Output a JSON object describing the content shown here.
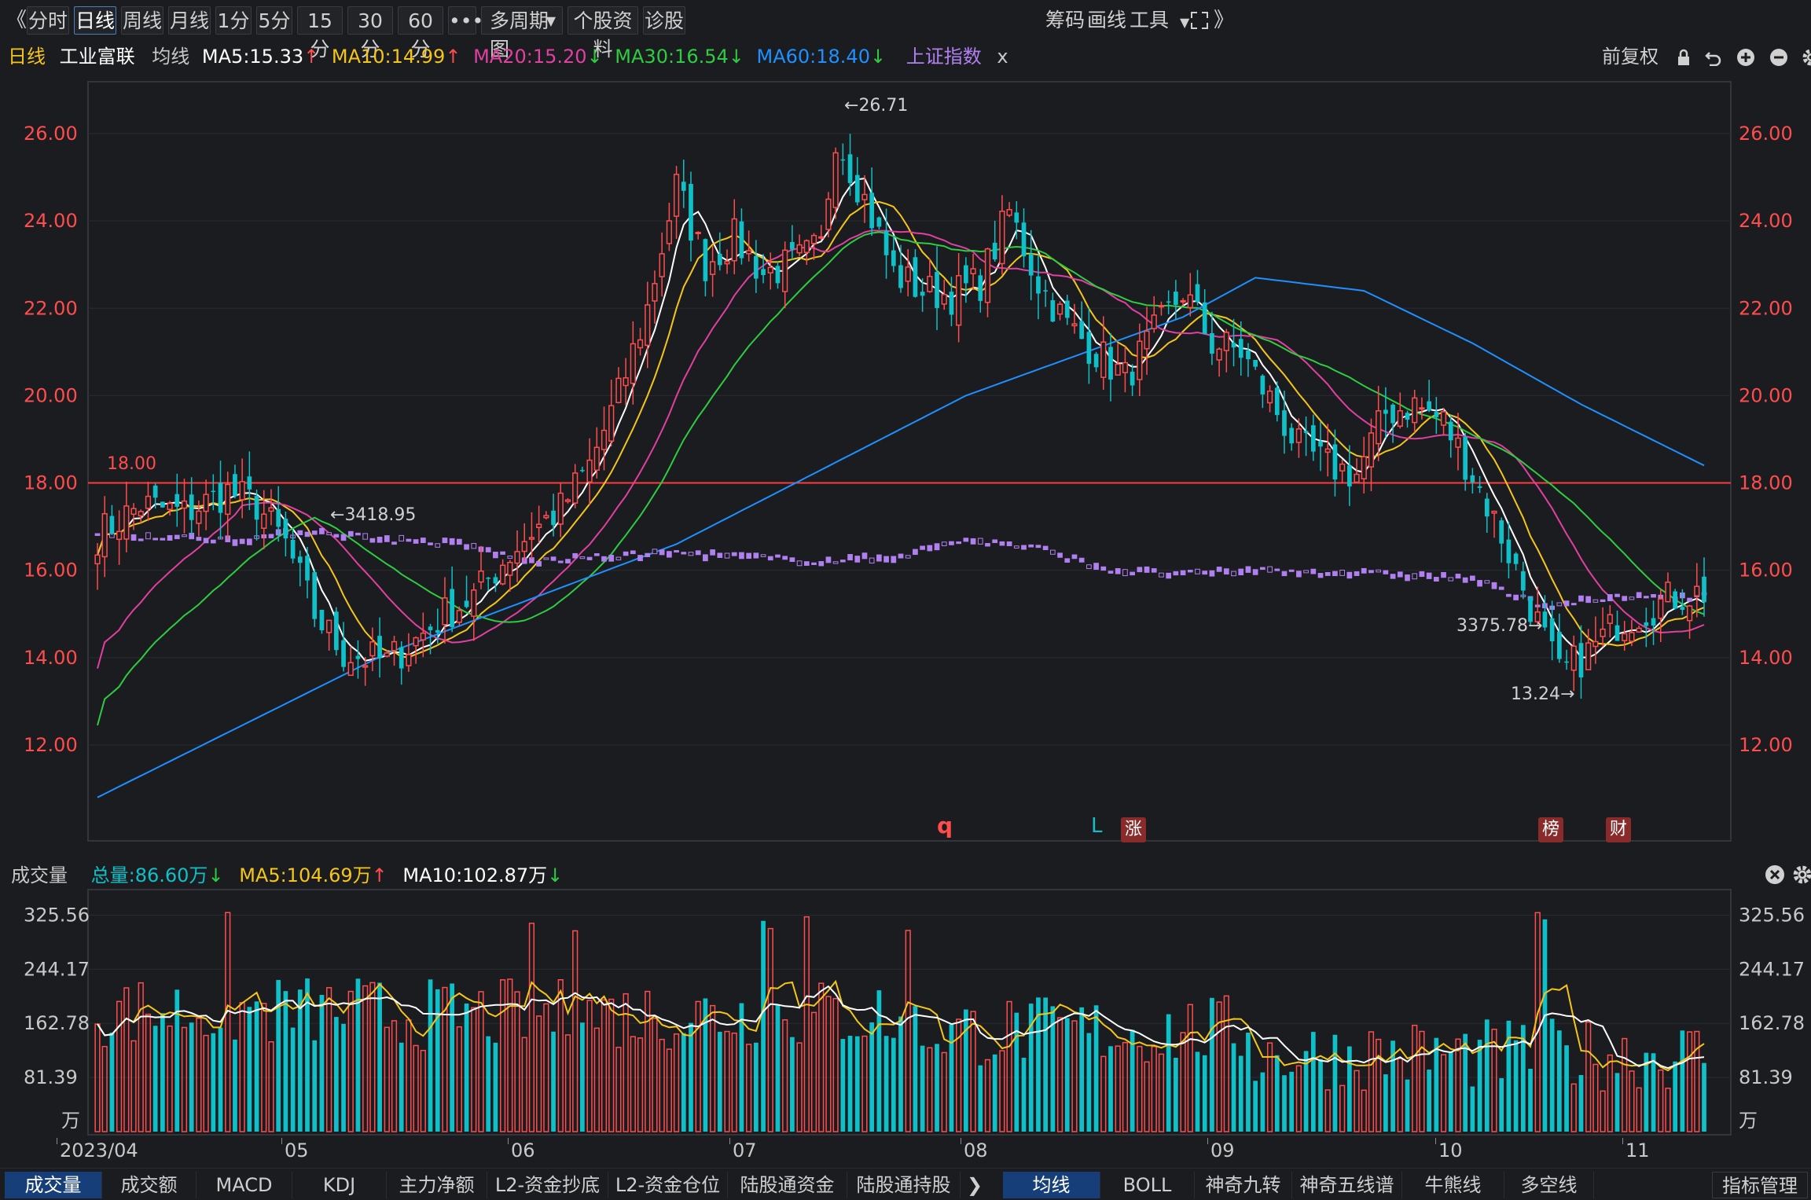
{
  "toolbar": {
    "back_glyph": "《",
    "buttons": [
      "分时",
      "日线",
      "周线",
      "月线",
      "1分",
      "5分",
      "15分",
      "30分",
      "60分",
      "•••",
      "多周期图",
      "个股资料",
      "诊股"
    ],
    "active": "日线",
    "right_items": [
      "筹码",
      "画线",
      "工具"
    ],
    "fullscreen_icon": "expand-icon",
    "forward_glyph": "》"
  },
  "legend": {
    "period": "日线",
    "stock_name": "工业富联",
    "ma_label": "均线",
    "ma5": "MA5:15.33",
    "ma10": "MA10:14.99",
    "ma20": "MA20:15.20",
    "ma30": "MA30:16.54",
    "ma60": "MA60:18.40",
    "index_overlay": "上证指数",
    "close_x": "x",
    "adjust": "前复权",
    "colors": {
      "ma5": "#ffffff",
      "ma10": "#f5c518",
      "ma20": "#e040a0",
      "ma30": "#2ecc40",
      "ma60": "#1e90ff",
      "index": "#b07ff0",
      "up": "#ff4d4d",
      "down": "#10c0c8"
    }
  },
  "price_axis": {
    "labels": [
      "26.00",
      "24.00",
      "22.00",
      "20.00",
      "18.00",
      "16.00",
      "14.00",
      "12.00"
    ],
    "ref_line_label": "18.00"
  },
  "annotations": {
    "high": "26.71",
    "low": "13.24",
    "index_high": "3418.95",
    "index_low": "3375.78",
    "markers": [
      "q",
      "L",
      "涨",
      "榜",
      "财"
    ]
  },
  "volume": {
    "title": "成交量",
    "total": "总量:86.60万",
    "ma5": "MA5:104.69万",
    "ma10": "MA10:102.87万",
    "axis_labels": [
      "325.56",
      "244.17",
      "162.78",
      "81.39",
      "万"
    ]
  },
  "x_axis": [
    "2023/04",
    "05",
    "06",
    "07",
    "08",
    "09",
    "10",
    "11"
  ],
  "bottom_tabs": {
    "left": [
      "成交量",
      "成交额",
      "MACD",
      "KDJ",
      "主力净额",
      "L2-资金抄底",
      "L2-资金仓位",
      "陆股通资金",
      "陆股通持股"
    ],
    "right": [
      "均线",
      "BOLL",
      "神奇九转",
      "神奇五线谱",
      "牛熊线",
      "多空线"
    ],
    "manage": "指标管理",
    "active_left": "成交量",
    "active_right": "均线"
  },
  "chart_data": {
    "type": "candlestick",
    "price_ylim": [
      10.9,
      27.0
    ],
    "volume_ylim": [
      0,
      350
    ],
    "candles": [],
    "note_series": [
      "MA5",
      "MA10",
      "MA20",
      "MA30",
      "MA60",
      "上证指数"
    ]
  }
}
